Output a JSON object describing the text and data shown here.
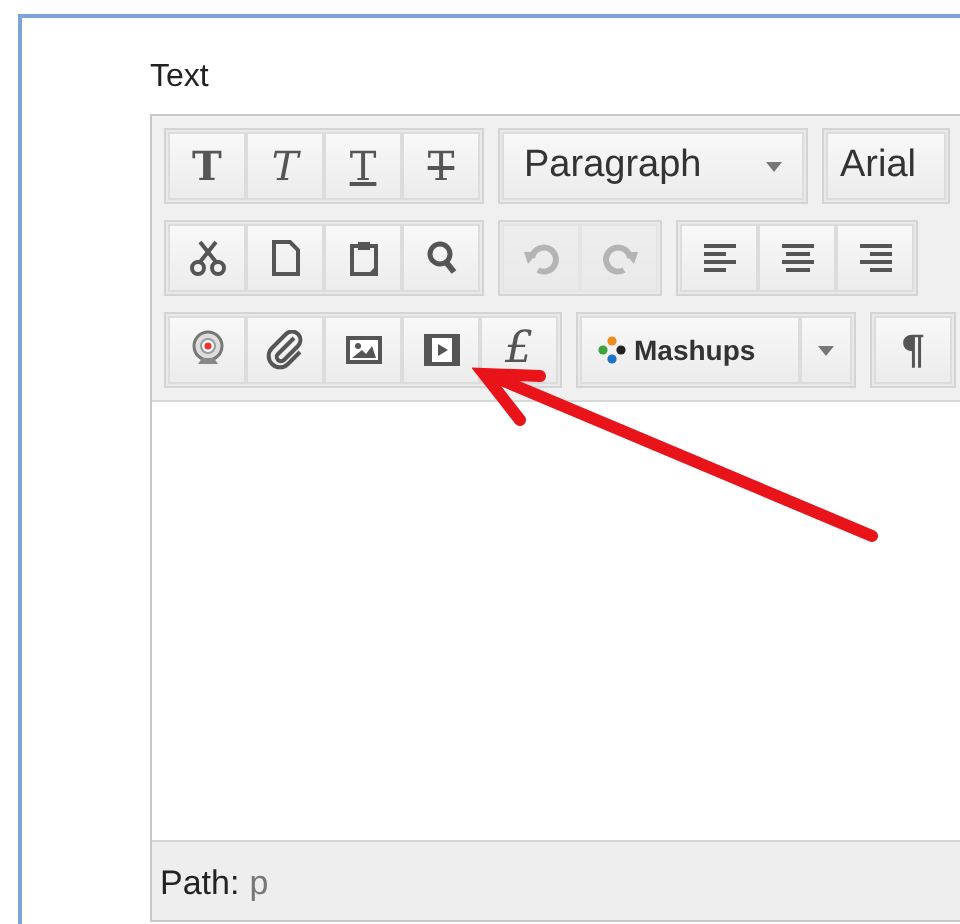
{
  "field_label": "Text",
  "toolbar": [
    [
      {
        "kind": "buttons",
        "items": [
          {
            "kind": "bold",
            "label": "T",
            "disabled": false
          },
          {
            "kind": "italic",
            "label": "T",
            "disabled": false
          },
          {
            "kind": "underline",
            "label": "T",
            "disabled": false
          },
          {
            "kind": "strikethrough",
            "label": "T",
            "disabled": false
          }
        ]
      },
      {
        "kind": "dropdown",
        "label": "Paragraph"
      },
      {
        "kind": "dropdown",
        "label": "Arial"
      }
    ],
    [
      {
        "kind": "buttons",
        "items": [
          {
            "kind": "cut",
            "disabled": false
          },
          {
            "kind": "copy",
            "disabled": false
          },
          {
            "kind": "paste",
            "disabled": false
          },
          {
            "kind": "find",
            "disabled": false
          }
        ]
      },
      {
        "kind": "buttons",
        "items": [
          {
            "kind": "undo",
            "disabled": true
          },
          {
            "kind": "redo",
            "disabled": true
          }
        ]
      },
      {
        "kind": "buttons",
        "items": [
          {
            "kind": "align-left",
            "disabled": false
          },
          {
            "kind": "align-center",
            "disabled": false
          },
          {
            "kind": "align-right",
            "disabled": false
          }
        ]
      }
    ],
    [
      {
        "kind": "buttons",
        "items": [
          {
            "kind": "webcam",
            "disabled": false
          },
          {
            "kind": "attach",
            "disabled": false
          },
          {
            "kind": "image",
            "disabled": false
          },
          {
            "kind": "video",
            "disabled": false
          },
          {
            "kind": "formula",
            "label": "£",
            "disabled": false
          }
        ]
      },
      {
        "kind": "mashup",
        "label": "Mashups"
      },
      {
        "kind": "buttons",
        "items": [
          {
            "kind": "pilcrow",
            "label": "¶",
            "disabled": false
          }
        ]
      }
    ]
  ],
  "path_bar": {
    "label": "Path:",
    "value": "p"
  }
}
